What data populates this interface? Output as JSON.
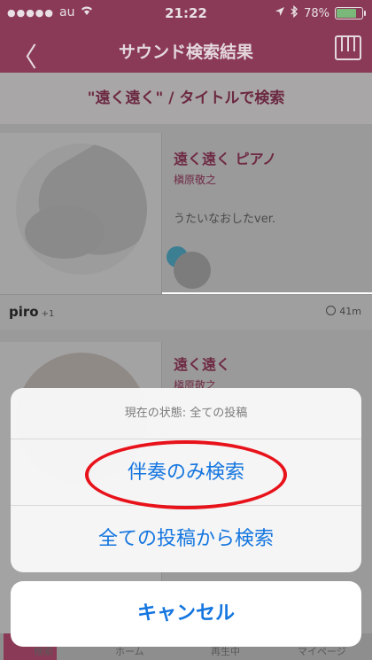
{
  "status_bar": {
    "carrier": "au",
    "signal_dots": "●●●●●",
    "time": "21:22",
    "battery": "78%",
    "battery_level": 0.78
  },
  "nav": {
    "back_glyph": "〈",
    "title": "サウンド検索結果"
  },
  "search_banner": "\"遠く遠く\" / タイトルで検索",
  "results": [
    {
      "title": "遠く遠く ピアノ",
      "artist": "槇原敬之",
      "comment": "うたいなおしたver.",
      "user": "piro",
      "user_extra": "+1",
      "time_ago": "41m"
    },
    {
      "title": "遠く遠く",
      "artist": "槇原敬之"
    }
  ],
  "tabbar": {
    "items": [
      "検索",
      "ホーム",
      "再生中",
      "マイページ"
    ]
  },
  "action_sheet": {
    "header": "現在の状態: 全ての投稿",
    "option_1": "伴奏のみ検索",
    "option_2": "全ての投稿から検索",
    "cancel": "キャンセル"
  },
  "colors": {
    "accent": "#8a3a56",
    "sheet_blue": "#1576e0",
    "annotation_red": "#e8121b"
  }
}
